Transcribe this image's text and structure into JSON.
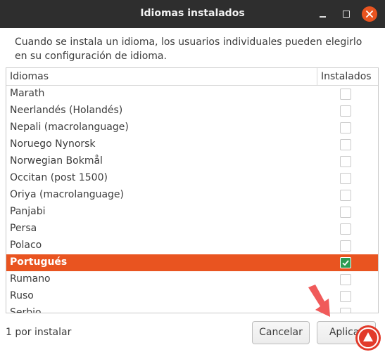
{
  "window": {
    "title": "Idiomas instalados"
  },
  "description": "Cuando se instala un idioma, los usuarios individuales pueden elegirlo en su configuración de idioma.",
  "table": {
    "columns": [
      "Idiomas",
      "Instalados"
    ],
    "rows": [
      {
        "name": "Marath",
        "installed": false,
        "selected": false
      },
      {
        "name": "Neerlandés (Holandés)",
        "installed": false,
        "selected": false
      },
      {
        "name": "Nepali (macrolanguage)",
        "installed": false,
        "selected": false
      },
      {
        "name": "Noruego Nynorsk",
        "installed": false,
        "selected": false
      },
      {
        "name": "Norwegian Bokmål",
        "installed": false,
        "selected": false
      },
      {
        "name": "Occitan (post 1500)",
        "installed": false,
        "selected": false
      },
      {
        "name": "Oriya (macrolanguage)",
        "installed": false,
        "selected": false
      },
      {
        "name": "Panjabi",
        "installed": false,
        "selected": false
      },
      {
        "name": "Persa",
        "installed": false,
        "selected": false
      },
      {
        "name": "Polaco",
        "installed": false,
        "selected": false
      },
      {
        "name": "Portugués",
        "installed": true,
        "selected": true
      },
      {
        "name": "Rumano",
        "installed": false,
        "selected": false
      },
      {
        "name": "Ruso",
        "installed": false,
        "selected": false
      },
      {
        "name": "Serbio",
        "installed": false,
        "selected": false
      }
    ]
  },
  "footer": {
    "status": "1 por instalar",
    "cancel_label": "Cancelar",
    "apply_label": "Aplicar"
  },
  "colors": {
    "selection": "#e95420",
    "titlebar": "#2e2e2e",
    "check_on": "#2b9c53",
    "pointer": "#f05a5a"
  },
  "icons": {
    "minimize": "minimize-icon",
    "maximize": "maximize-icon",
    "close": "close-icon",
    "checkmark": "checkmark-icon",
    "pointer": "arrow-pointer-icon",
    "watermark": "watermark-logo"
  }
}
